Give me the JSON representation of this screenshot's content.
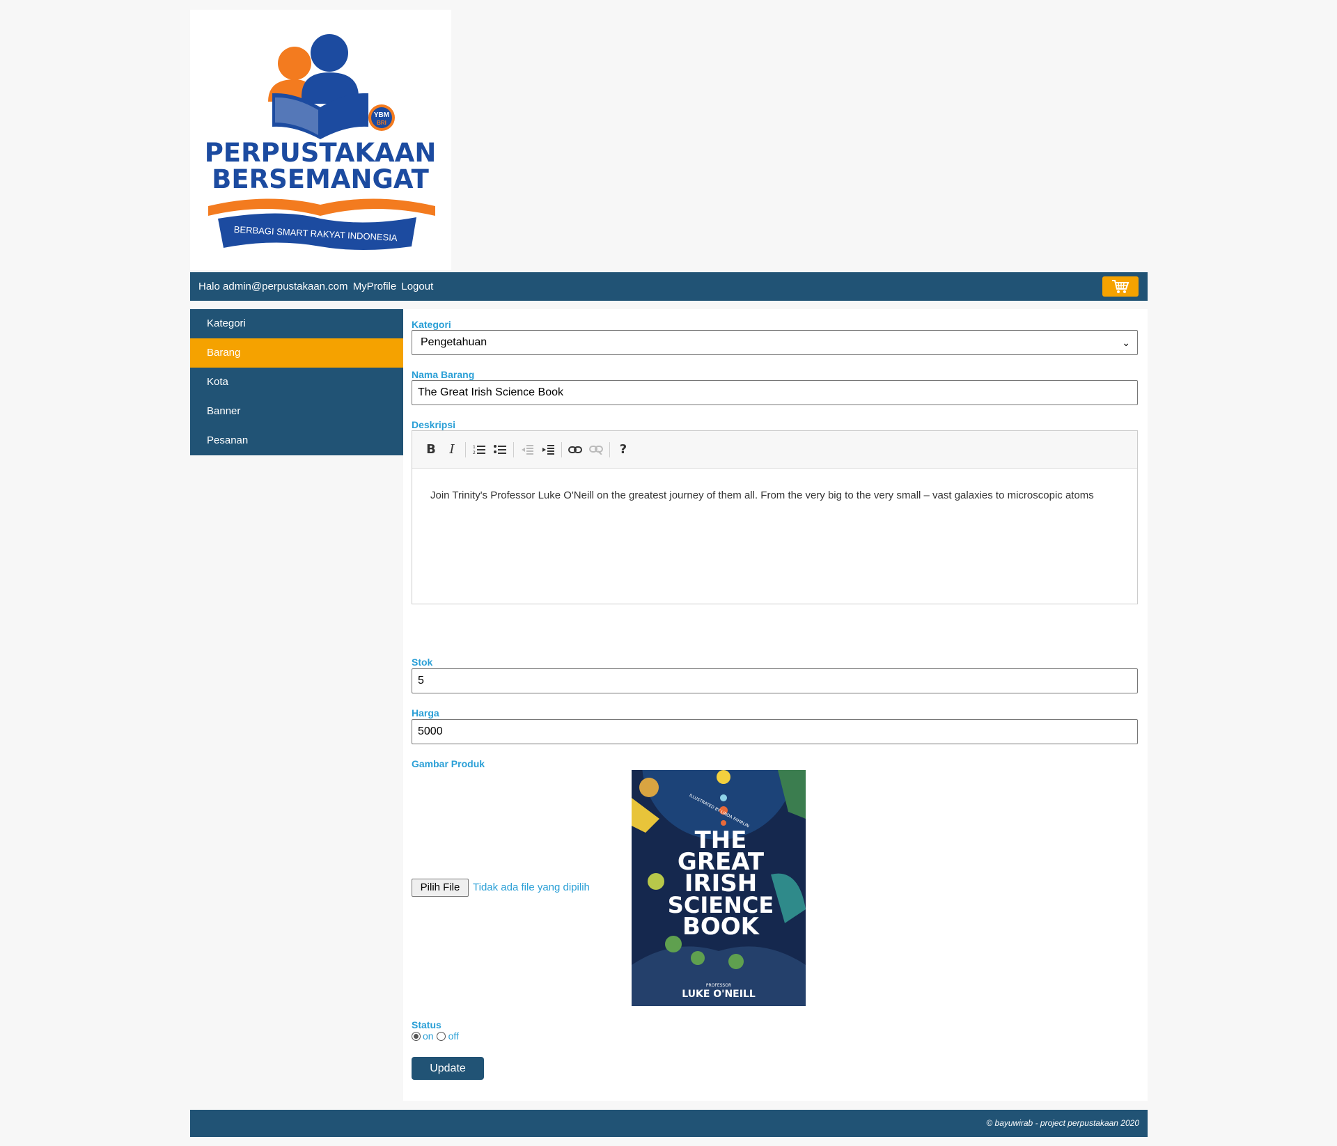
{
  "logo": {
    "line1": "PERPUSTAKAAN",
    "line2": "BERSEMANGAT",
    "ribbon": "BERBAGI SMART RAKYAT INDONESIA",
    "badge_top": "YBM",
    "badge_bottom": "BRI"
  },
  "topbar": {
    "greeting": "Halo admin@perpustakaan.com",
    "profile_link": "MyProfile",
    "logout_link": "Logout",
    "cart_icon": "shopping-cart-icon",
    "colors": {
      "bar": "#215375",
      "accent": "#f5a200"
    }
  },
  "sidebar": {
    "items": [
      {
        "label": "Kategori",
        "active": false
      },
      {
        "label": "Barang",
        "active": true
      },
      {
        "label": "Kota",
        "active": false
      },
      {
        "label": "Banner",
        "active": false
      },
      {
        "label": "Pesanan",
        "active": false
      }
    ]
  },
  "form": {
    "kategori": {
      "label": "Kategori",
      "value": "Pengetahuan"
    },
    "nama_barang": {
      "label": "Nama Barang",
      "value": "The Great Irish Science Book"
    },
    "deskripsi": {
      "label": "Deskripsi",
      "toolbar": [
        "bold-icon",
        "italic-icon",
        "ordered-list-icon",
        "unordered-list-icon",
        "outdent-icon",
        "indent-icon",
        "link-icon",
        "unlink-icon",
        "help-icon"
      ],
      "text": "Join Trinity's Professor Luke O'Neill on the greatest journey of them all. From the very big to the very small – vast galaxies to microscopic atoms"
    },
    "stok": {
      "label": "Stok",
      "value": "5"
    },
    "harga": {
      "label": "Harga",
      "value": "5000"
    },
    "gambar": {
      "label": "Gambar Produk",
      "button": "Pilih File",
      "no_file": "Tidak ada file yang dipilih",
      "cover": {
        "title_lines": [
          "THE",
          "GREAT",
          "IRISH",
          "SCIENCE",
          "BOOK"
        ],
        "author_prefix": "PROFESSOR",
        "author": "LUKE O'NEILL",
        "illustrator": "ILLUSTRATED BY LINDA FAHRLIN"
      }
    },
    "status": {
      "label": "Status",
      "on": "on",
      "off": "off",
      "selected": "on"
    },
    "submit": "Update"
  },
  "footer": {
    "text": "© bayuwirab - project perpustakaan 2020"
  }
}
